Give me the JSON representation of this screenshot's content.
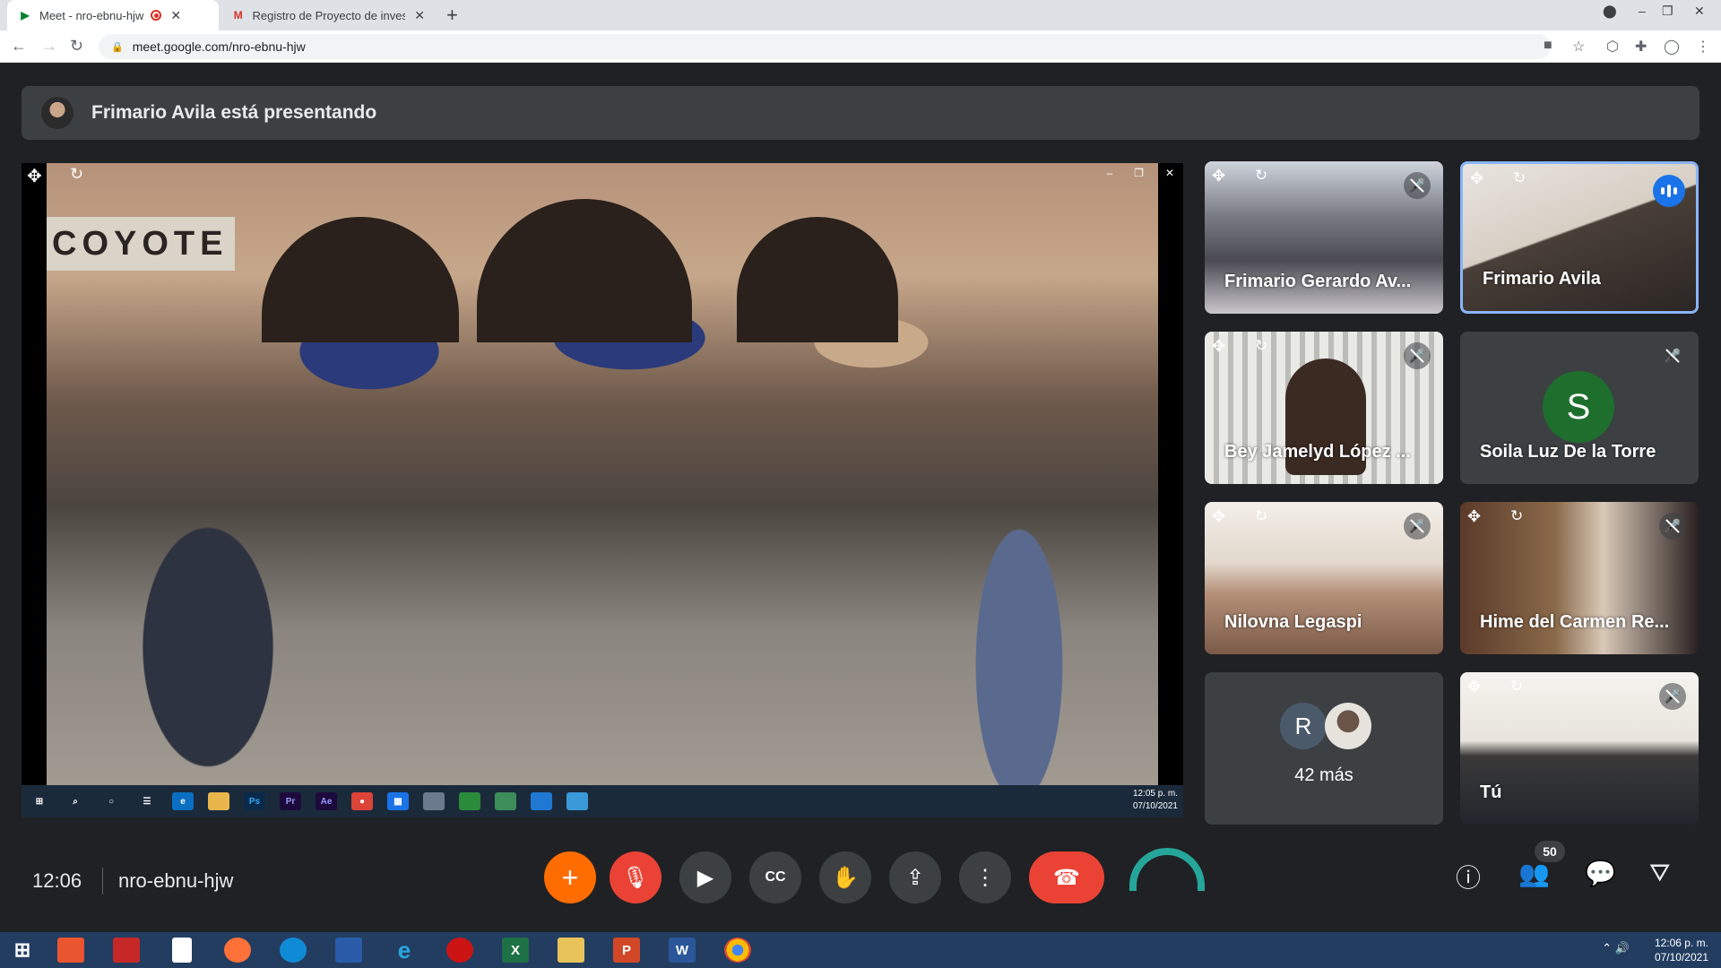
{
  "browser": {
    "tabs": [
      {
        "title": "Meet - nro-ebnu-hjw",
        "active": true
      },
      {
        "title": "Registro de Proyecto de investig",
        "active": false
      }
    ],
    "url": "meet.google.com/nro-ebnu-hjw"
  },
  "meet": {
    "presenter_text": "Frimario Avila está presentando",
    "meeting_time": "12:06",
    "meeting_code": "nro-ebnu-hjw",
    "participant_count": "50",
    "tiles": [
      {
        "name": "Frimario Gerardo Av..."
      },
      {
        "name": "Frimario Avila"
      },
      {
        "name": "Bey Jamelyd López ..."
      },
      {
        "name": "Soila Luz De la Torre",
        "initial": "S"
      },
      {
        "name": "Nilovna Legaspi"
      },
      {
        "name": "Hime del Carmen Re..."
      },
      {
        "label": "42 más",
        "initial": "R"
      },
      {
        "name": "Tú"
      }
    ],
    "shared_screen": {
      "sign": "COYOTE",
      "taskbar_time": "12:05 p. m.",
      "taskbar_date": "07/10/2021"
    }
  },
  "windows_taskbar": {
    "time": "12:06 p. m.",
    "date": "07/10/2021"
  }
}
